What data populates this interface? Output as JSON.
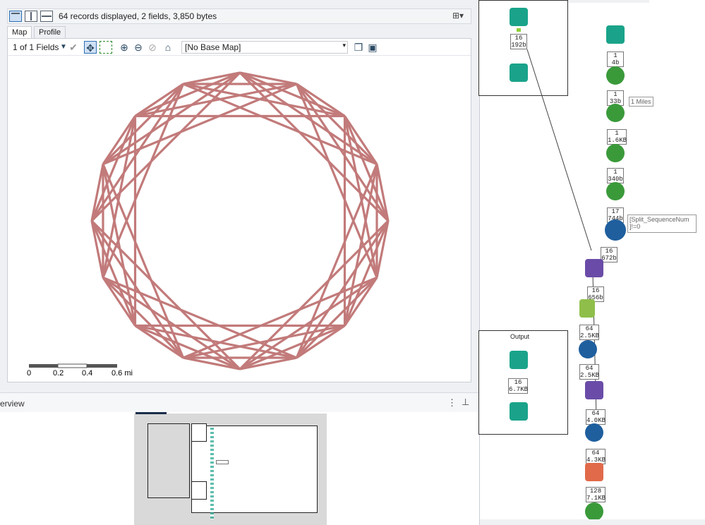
{
  "results": {
    "records_text": "64 records displayed, 2 fields, 3,850 bytes",
    "tabs": [
      "Map",
      "Profile"
    ],
    "fields_selector": "1 of 1 Fields",
    "base_map": "[No Base Map]",
    "scale_labels": [
      "0",
      "0.2",
      "0.4",
      "0.6 mi"
    ]
  },
  "overview": {
    "title": "erview"
  },
  "workflow": {
    "container_title": "Output",
    "badges": {
      "b1": [
        "16",
        "192b"
      ],
      "b2": [
        "1",
        "4b"
      ],
      "b3": [
        "1",
        "33b"
      ],
      "b4": [
        "1",
        "1.6KB"
      ],
      "b5": [
        "1",
        "340b"
      ],
      "b6": [
        "17",
        "744b"
      ],
      "b7": [
        "16",
        "672b"
      ],
      "b8": [
        "16",
        "656b"
      ],
      "b9": [
        "64",
        "2.5KB"
      ],
      "b10": [
        "64",
        "2.5KB"
      ],
      "b11": [
        "16",
        "6.7KB"
      ],
      "b12": [
        "64",
        "4.0KB"
      ],
      "b13": [
        "64",
        "4.3KB"
      ],
      "b14": [
        "128",
        "7.1KB"
      ]
    },
    "annotations": {
      "miles": "1 Miles",
      "filter_line1": "[Split_SequenceNum",
      "filter_line2": "]!=0"
    }
  },
  "colors": {
    "star_line": "#c27a7a",
    "in_out_tool": "#1aa38a",
    "spatial_tool": "#3a9a3a",
    "join_tool": "#6a4ca8",
    "filter_tool": "#1f5f9e",
    "formula_tool": "#8fbf4a",
    "output_tool": "#e06a4a"
  }
}
